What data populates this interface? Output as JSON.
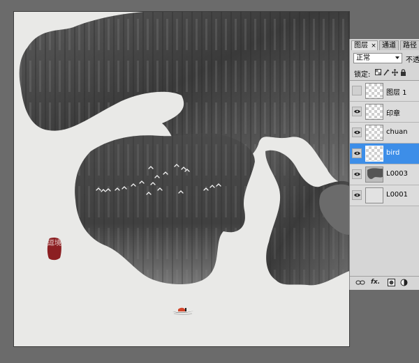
{
  "canvas": {
    "seal_text": "逗境"
  },
  "layers_panel": {
    "tabs": [
      {
        "label": "图层",
        "active": true,
        "close": "×"
      },
      {
        "label": "通道",
        "active": false
      },
      {
        "label": "路径",
        "active": false
      }
    ],
    "blend_mode": "正常",
    "opacity_label": "不透明",
    "lock_label": "锁定:",
    "layers": [
      {
        "name": "图层 1",
        "visible": false,
        "thumb": "transparent",
        "selected": false
      },
      {
        "name": "印章",
        "visible": true,
        "thumb": "transparent",
        "selected": false
      },
      {
        "name": "chuan",
        "visible": true,
        "thumb": "transparent",
        "selected": false
      },
      {
        "name": "bird",
        "visible": true,
        "thumb": "transparent",
        "selected": true
      },
      {
        "name": "L0003",
        "visible": true,
        "thumb": "ink",
        "selected": false
      },
      {
        "name": "L0001",
        "visible": true,
        "thumb": "plain",
        "selected": false
      }
    ],
    "footer_icons": [
      "link-icon",
      "fx-icon",
      "mask-icon",
      "adjustment-icon"
    ],
    "footer_fx_label": "fx."
  },
  "colors": {
    "selection": "#3d8ee8",
    "seal_red": "#8c1f22",
    "ink_dark": "#3f3f3f",
    "paper": "#e9e9e7"
  }
}
